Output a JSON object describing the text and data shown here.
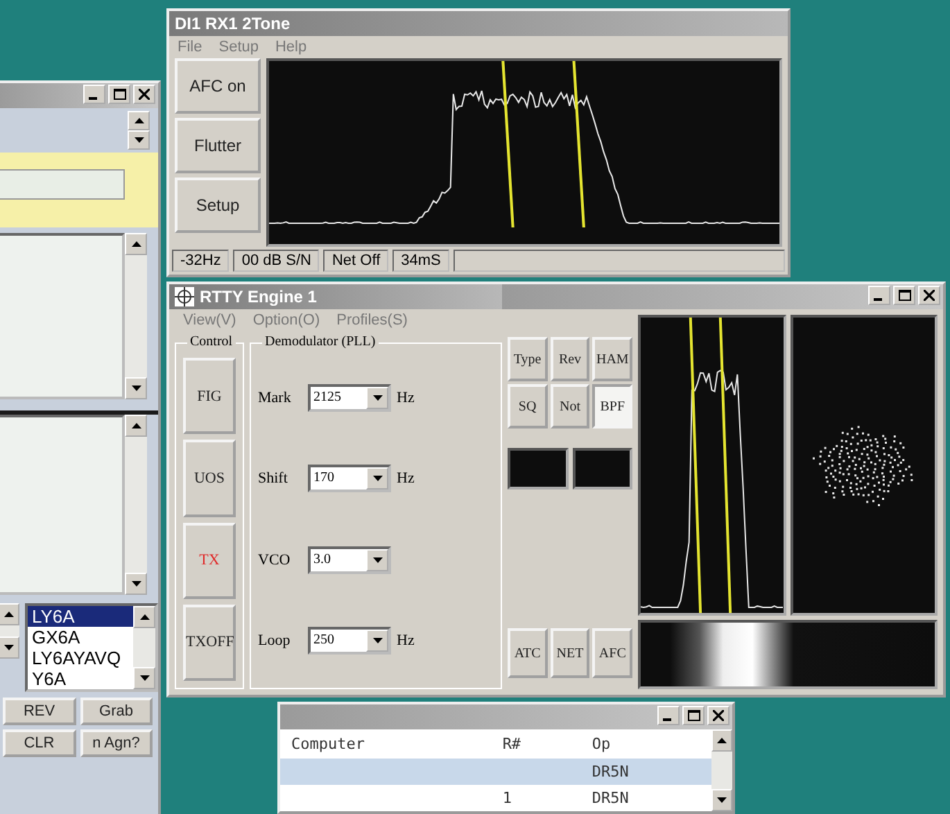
{
  "left_window": {
    "list": [
      {
        "text": "LY6A",
        "selected": true
      },
      {
        "text": "GX6A",
        "selected": false
      },
      {
        "text": "LY6AYAVQ",
        "selected": false
      },
      {
        "text": "Y6A",
        "selected": false
      }
    ],
    "buttons": [
      "REV",
      "Grab",
      "CLR",
      "n Agn?"
    ]
  },
  "rx_window": {
    "title": "DI1 RX1 2Tone",
    "menu": [
      "File",
      "Setup",
      "Help"
    ],
    "buttons": [
      "AFC on",
      "Flutter",
      "Setup"
    ],
    "status": [
      "-32Hz",
      "00 dB S/N",
      "Net Off",
      "34mS"
    ]
  },
  "rtty_window": {
    "title": "RTTY Engine 1",
    "menu": [
      "View(V)",
      "Option(O)",
      "Profiles(S)"
    ],
    "control_group": {
      "label": "Control",
      "buttons": [
        {
          "label": "FIG",
          "kind": "normal"
        },
        {
          "label": "UOS",
          "kind": "normal"
        },
        {
          "label": "TX",
          "kind": "alert"
        },
        {
          "label": "TXOFF",
          "kind": "normal"
        }
      ]
    },
    "demod_group": {
      "label": "Demodulator (PLL)",
      "fields": [
        {
          "label": "Mark",
          "value": "2125",
          "unit": "Hz"
        },
        {
          "label": "Shift",
          "value": "170",
          "unit": "Hz"
        },
        {
          "label": "VCO",
          "value": "3.0"
        },
        {
          "label": "Loop",
          "value": "250",
          "unit": "Hz"
        }
      ],
      "toggles": [
        {
          "label": "Type",
          "on": false
        },
        {
          "label": "Rev",
          "on": false
        },
        {
          "label": "HAM",
          "on": false
        },
        {
          "label": "SQ",
          "on": false
        },
        {
          "label": "Not",
          "on": false
        },
        {
          "label": "BPF",
          "on": true
        }
      ],
      "buttons": [
        "ATC",
        "NET",
        "AFC"
      ]
    }
  },
  "log_window": {
    "columns": [
      "Computer",
      "R#",
      "Op"
    ],
    "rows": [
      {
        "op": "DR5N",
        "selected": true
      },
      {
        "r_num": "1",
        "op": "DR5N",
        "selected": false
      }
    ]
  }
}
